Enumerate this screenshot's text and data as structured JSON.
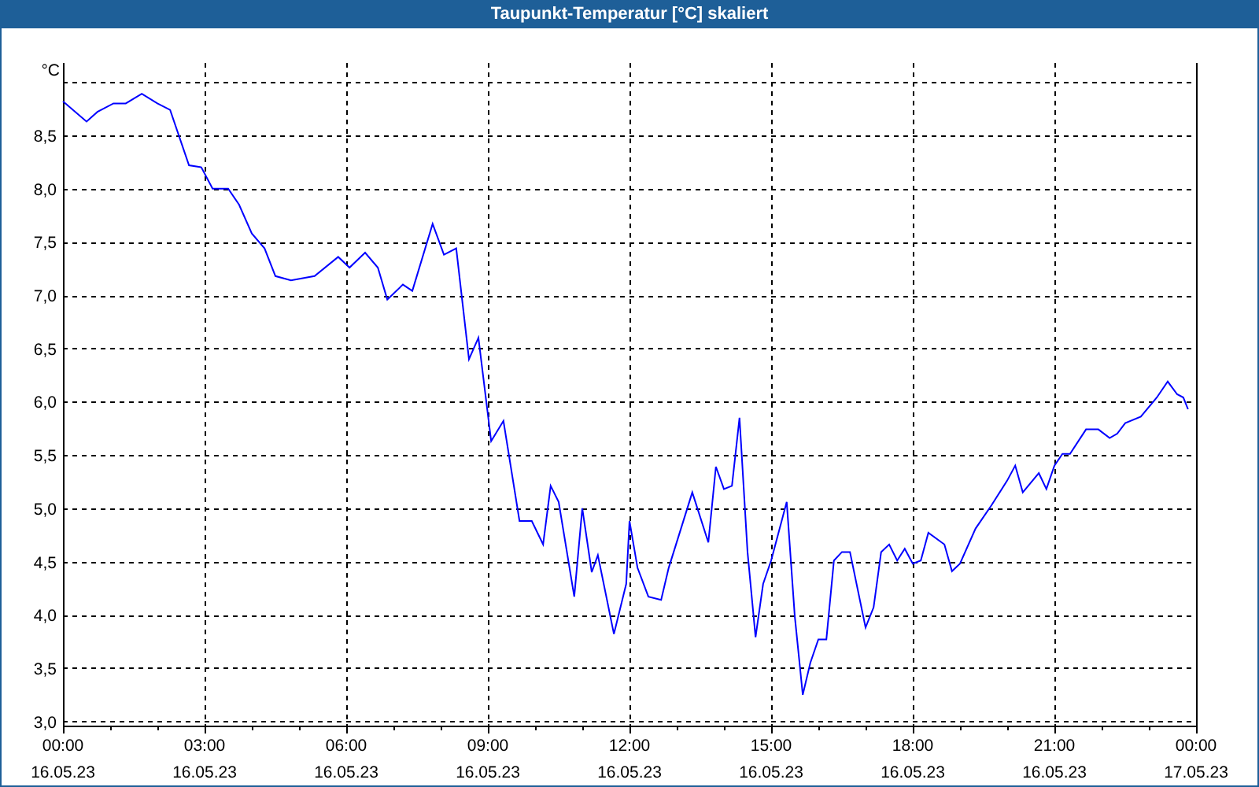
{
  "chart_data": {
    "type": "line",
    "title": "Taupunkt-Temperatur [°C] skaliert",
    "ylabel": "°C",
    "x": [
      0,
      0.5,
      0.73,
      1.07,
      1.33,
      1.67,
      2.0,
      2.27,
      2.67,
      2.93,
      3.17,
      3.5,
      3.73,
      4.0,
      4.27,
      4.5,
      4.83,
      5.33,
      5.83,
      6.07,
      6.4,
      6.67,
      6.87,
      7.2,
      7.4,
      7.83,
      8.07,
      8.33,
      8.6,
      8.8,
      9.07,
      9.33,
      9.67,
      9.93,
      10.17,
      10.33,
      10.5,
      10.83,
      11.0,
      11.2,
      11.33,
      11.67,
      11.93,
      12.0,
      12.17,
      12.4,
      12.67,
      12.83,
      13.33,
      13.67,
      13.83,
      14.0,
      14.17,
      14.33,
      14.5,
      14.67,
      14.83,
      15.0,
      15.33,
      15.5,
      15.67,
      15.83,
      16.0,
      16.17,
      16.33,
      16.5,
      16.67,
      17.0,
      17.17,
      17.33,
      17.5,
      17.67,
      17.83,
      18.0,
      18.17,
      18.33,
      18.67,
      18.83,
      19.0,
      19.33,
      19.67,
      20.0,
      20.17,
      20.33,
      20.67,
      20.83,
      21.0,
      21.17,
      21.33,
      21.67,
      21.93,
      22.17,
      22.33,
      22.5,
      22.83,
      23.17,
      23.4,
      23.6,
      23.73,
      23.83
    ],
    "series": [
      {
        "color": "#0000ff",
        "values": [
          8.82,
          8.63,
          8.72,
          8.8,
          8.8,
          8.89,
          8.8,
          8.74,
          8.22,
          8.2,
          8.0,
          8.0,
          7.85,
          7.58,
          7.44,
          7.18,
          7.14,
          7.18,
          7.36,
          7.26,
          7.4,
          7.26,
          6.96,
          7.1,
          7.04,
          7.67,
          7.38,
          7.44,
          6.4,
          6.6,
          5.63,
          5.82,
          4.88,
          4.88,
          4.66,
          5.21,
          5.06,
          4.17,
          5.0,
          4.4,
          4.56,
          3.82,
          4.29,
          4.88,
          4.44,
          4.17,
          4.14,
          4.44,
          5.15,
          4.68,
          5.39,
          5.18,
          5.21,
          5.85,
          4.59,
          3.79,
          4.29,
          4.51,
          5.06,
          3.99,
          3.25,
          3.55,
          3.77,
          3.77,
          4.51,
          4.59,
          4.59,
          3.88,
          4.07,
          4.59,
          4.66,
          4.51,
          4.62,
          4.48,
          4.51,
          4.77,
          4.66,
          4.41,
          4.48,
          4.81,
          5.03,
          5.26,
          5.4,
          5.15,
          5.33,
          5.18,
          5.4,
          5.51,
          5.51,
          5.74,
          5.74,
          5.66,
          5.7,
          5.8,
          5.86,
          6.04,
          6.19,
          6.07,
          6.04,
          5.93
        ]
      }
    ],
    "xlim": [
      0,
      24
    ],
    "ylim": [
      2.96,
      9.18
    ],
    "xticks": [
      {
        "value": 0,
        "label": "00:00"
      },
      {
        "value": 3,
        "label": "03:00"
      },
      {
        "value": 6,
        "label": "06:00"
      },
      {
        "value": 9,
        "label": "09:00"
      },
      {
        "value": 12,
        "label": "12:00"
      },
      {
        "value": 15,
        "label": "15:00"
      },
      {
        "value": 18,
        "label": "18:00"
      },
      {
        "value": 21,
        "label": "21:00"
      },
      {
        "value": 24,
        "label": "00:00"
      }
    ],
    "grid": true,
    "yticks": [
      {
        "value": 3,
        "label": "3,0"
      },
      {
        "value": 3.5,
        "label": "3,5"
      },
      {
        "value": 4,
        "label": "4,0"
      },
      {
        "value": 4.5,
        "label": "4,5"
      },
      {
        "value": 5,
        "label": "5,0"
      },
      {
        "value": 5.5,
        "label": "5,5"
      },
      {
        "value": 6,
        "label": "6,0"
      },
      {
        "value": 6.5,
        "label": "6,5"
      },
      {
        "value": 7,
        "label": "7,0"
      },
      {
        "value": 7.5,
        "label": "7,5"
      },
      {
        "value": 8,
        "label": "8,0"
      },
      {
        "value": 8.5,
        "label": "8,5"
      }
    ]
  },
  "x_axis_dates": [
    "16.05.23",
    "16.05.23",
    "16.05.23",
    "16.05.23",
    "16.05.23",
    "16.05.23",
    "16.05.23",
    "16.05.23",
    "17.05.23"
  ]
}
